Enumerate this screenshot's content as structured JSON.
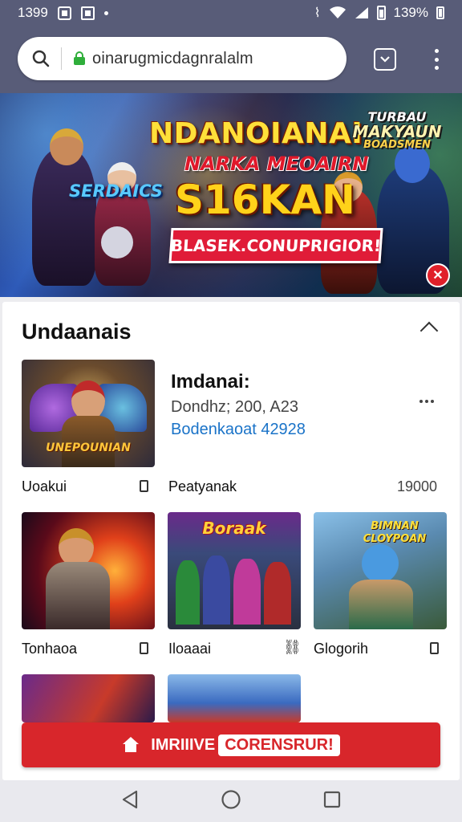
{
  "status_bar": {
    "time": "1399",
    "battery": "139%"
  },
  "browser": {
    "url": "oinarugmicdagnralalm",
    "icons": [
      "search-icon",
      "lock-icon",
      "tab-switcher-icon",
      "overflow-menu-icon"
    ]
  },
  "banner": {
    "title": "NDANOIANAI",
    "subtitle": "NARKA MEOAIRN",
    "big_text": "S16KAN",
    "left_text": "SERDAICS",
    "right_text_1": "TURBAU",
    "right_text_2": "MAKYAUN",
    "right_text_3": "BOADSMEN",
    "cta": "BLASEK.CONUPRIGIOR!",
    "close_icon": "close-icon"
  },
  "section": {
    "title": "Undaanais",
    "featured": {
      "title": "Imdanai:",
      "meta": "Dondhz; 200, A23",
      "link": "Bodenkaoat 42928",
      "image_caption": "UNEPOUNIAN"
    },
    "row1": {
      "left_caption": "Uoakui",
      "right_caption": "Peatyanak",
      "right_count": "19000"
    },
    "grid": [
      {
        "caption": "Tonhaoa",
        "icon": "bookmark-icon"
      },
      {
        "caption": "Iloaaai",
        "icon": "link-icon",
        "art_text": "Boraak"
      },
      {
        "caption": "Glogorih",
        "icon": "bookmark-icon",
        "art_text": "BIMNAN CLOYPOAN"
      }
    ]
  },
  "cta_button": {
    "label": "IMRIIIVE",
    "highlight": "CORENSRUR!"
  },
  "colors": {
    "chrome": "#585c78",
    "accent_red": "#d8262b",
    "link_blue": "#1a73c8"
  }
}
